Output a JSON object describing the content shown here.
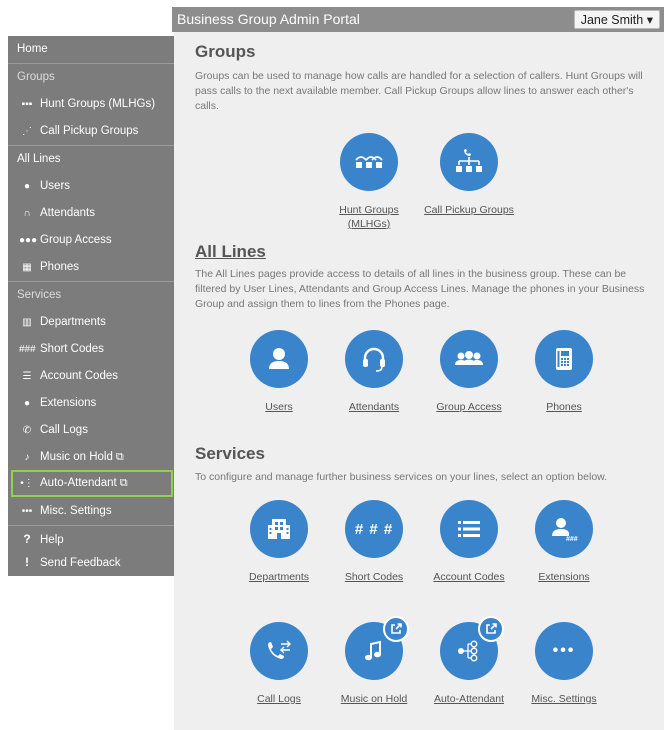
{
  "header": {
    "title": "Business Group Admin Portal",
    "user_name": "Jane Smith",
    "user_caret": "▾"
  },
  "sidebar": {
    "items": [
      {
        "label": "Home"
      },
      {
        "label": "Groups"
      },
      {
        "label": "Hunt Groups (MLHGs)"
      },
      {
        "label": "Call Pickup Groups"
      },
      {
        "label": "All Lines"
      },
      {
        "label": "Users"
      },
      {
        "label": "Attendants"
      },
      {
        "label": "Group Access"
      },
      {
        "label": "Phones"
      },
      {
        "label": "Services"
      },
      {
        "label": "Departments"
      },
      {
        "label": "Short Codes"
      },
      {
        "label": "Account Codes"
      },
      {
        "label": "Extensions"
      },
      {
        "label": "Call Logs"
      },
      {
        "label": "Music on Hold"
      },
      {
        "label": "Auto-Attendant"
      },
      {
        "label": "Misc. Settings"
      },
      {
        "label": "Help"
      },
      {
        "label": "Send Feedback"
      }
    ],
    "selected": "Auto-Attendant"
  },
  "main": {
    "groups": {
      "heading": "Groups",
      "description": "Groups can be used to manage how calls are handled for a selection of callers. Hunt Groups will pass calls to the next available member. Call Pickup Groups allow lines to answer each other's calls.",
      "tiles": [
        {
          "label": "Hunt Groups (MLHGs)",
          "icon": "hunt-group-icon"
        },
        {
          "label": "Call Pickup Groups",
          "icon": "call-pickup-icon"
        }
      ]
    },
    "all_lines": {
      "heading": "All Lines",
      "description": "The All Lines pages provide access to details of all lines in the business group. These can be filtered by User Lines, Attendants and Group Access Lines. Manage the phones in your Business Group and assign them to lines from the Phones page.",
      "tiles": [
        {
          "label": "Users",
          "icon": "user-icon"
        },
        {
          "label": "Attendants",
          "icon": "headset-icon"
        },
        {
          "label": "Group Access",
          "icon": "group-access-icon"
        },
        {
          "label": "Phones",
          "icon": "phone-icon"
        }
      ]
    },
    "services": {
      "heading": "Services",
      "description": "To configure and manage further business services on your lines, select an option below.",
      "short_codes_glyph": "# # #",
      "misc_glyph": "•••",
      "tiles": [
        {
          "label": "Departments",
          "icon": "building-icon"
        },
        {
          "label": "Short Codes",
          "icon": "hash-icon"
        },
        {
          "label": "Account Codes",
          "icon": "list-icon"
        },
        {
          "label": "Extensions",
          "icon": "user-hash-icon"
        },
        {
          "label": "Call Logs",
          "icon": "call-log-icon"
        },
        {
          "label": "Music on Hold",
          "icon": "music-icon"
        },
        {
          "label": "Auto-Attendant",
          "icon": "auto-attendant-icon"
        },
        {
          "label": "Misc. Settings",
          "icon": "ellipsis-icon"
        }
      ]
    }
  },
  "colors": {
    "accent": "#3a84cc",
    "sidebar": "#7c7c7c",
    "selected_border": "#8fd14f"
  }
}
